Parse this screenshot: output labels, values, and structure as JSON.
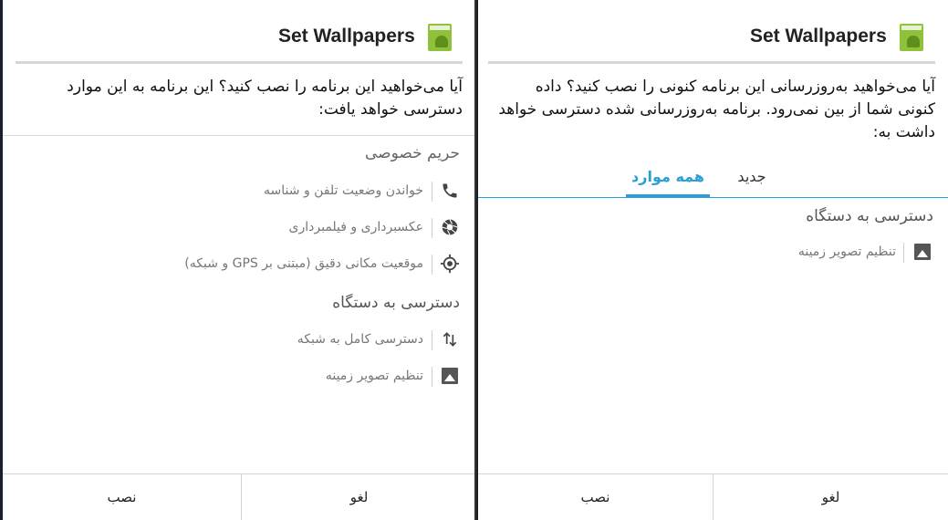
{
  "colors": {
    "accent": "#2a9fd6",
    "icon_green": "#8fc23a"
  },
  "left": {
    "title": "Set Wallpapers",
    "icon": "app-icon",
    "question": "آیا می‌خواهید این برنامه را نصب کنید؟ این برنامه به این موارد دسترسی خواهد یافت:",
    "sections": [
      {
        "heading": "حریم خصوصی",
        "items": [
          {
            "icon": "phone-icon",
            "label": "خواندن وضعیت تلفن و شناسه"
          },
          {
            "icon": "camera-icon",
            "label": "عکسبرداری و فیلمبرداری"
          },
          {
            "icon": "location-icon",
            "label": "موقعیت مکانی دقیق (مبتنی بر GPS و شبکه)"
          }
        ]
      },
      {
        "heading": "دسترسی به دستگاه",
        "items": [
          {
            "icon": "network-arrows-icon",
            "label": "دسترسی کامل به شبکه"
          },
          {
            "icon": "picture-icon",
            "label": "تنظیم تصویر زمینه"
          }
        ]
      }
    ],
    "buttons": {
      "install": "نصب",
      "cancel": "لغو"
    }
  },
  "right": {
    "title": "Set Wallpapers",
    "icon": "app-icon",
    "question": "آیا می‌خواهید به‌روزرسانی این برنامه کنونی را نصب کنید؟ داده کنونی شما از بین نمی‌رود. برنامه به‌روزرسانی شده دسترسی خواهد داشت به:",
    "tabs": {
      "new": "جدید",
      "all": "همه موارد",
      "selected": "all"
    },
    "section": {
      "heading": "دسترسی به دستگاه",
      "items": [
        {
          "icon": "picture-icon",
          "label": "تنظیم تصویر زمینه"
        }
      ]
    },
    "buttons": {
      "install": "نصب",
      "cancel": "لغو"
    }
  }
}
